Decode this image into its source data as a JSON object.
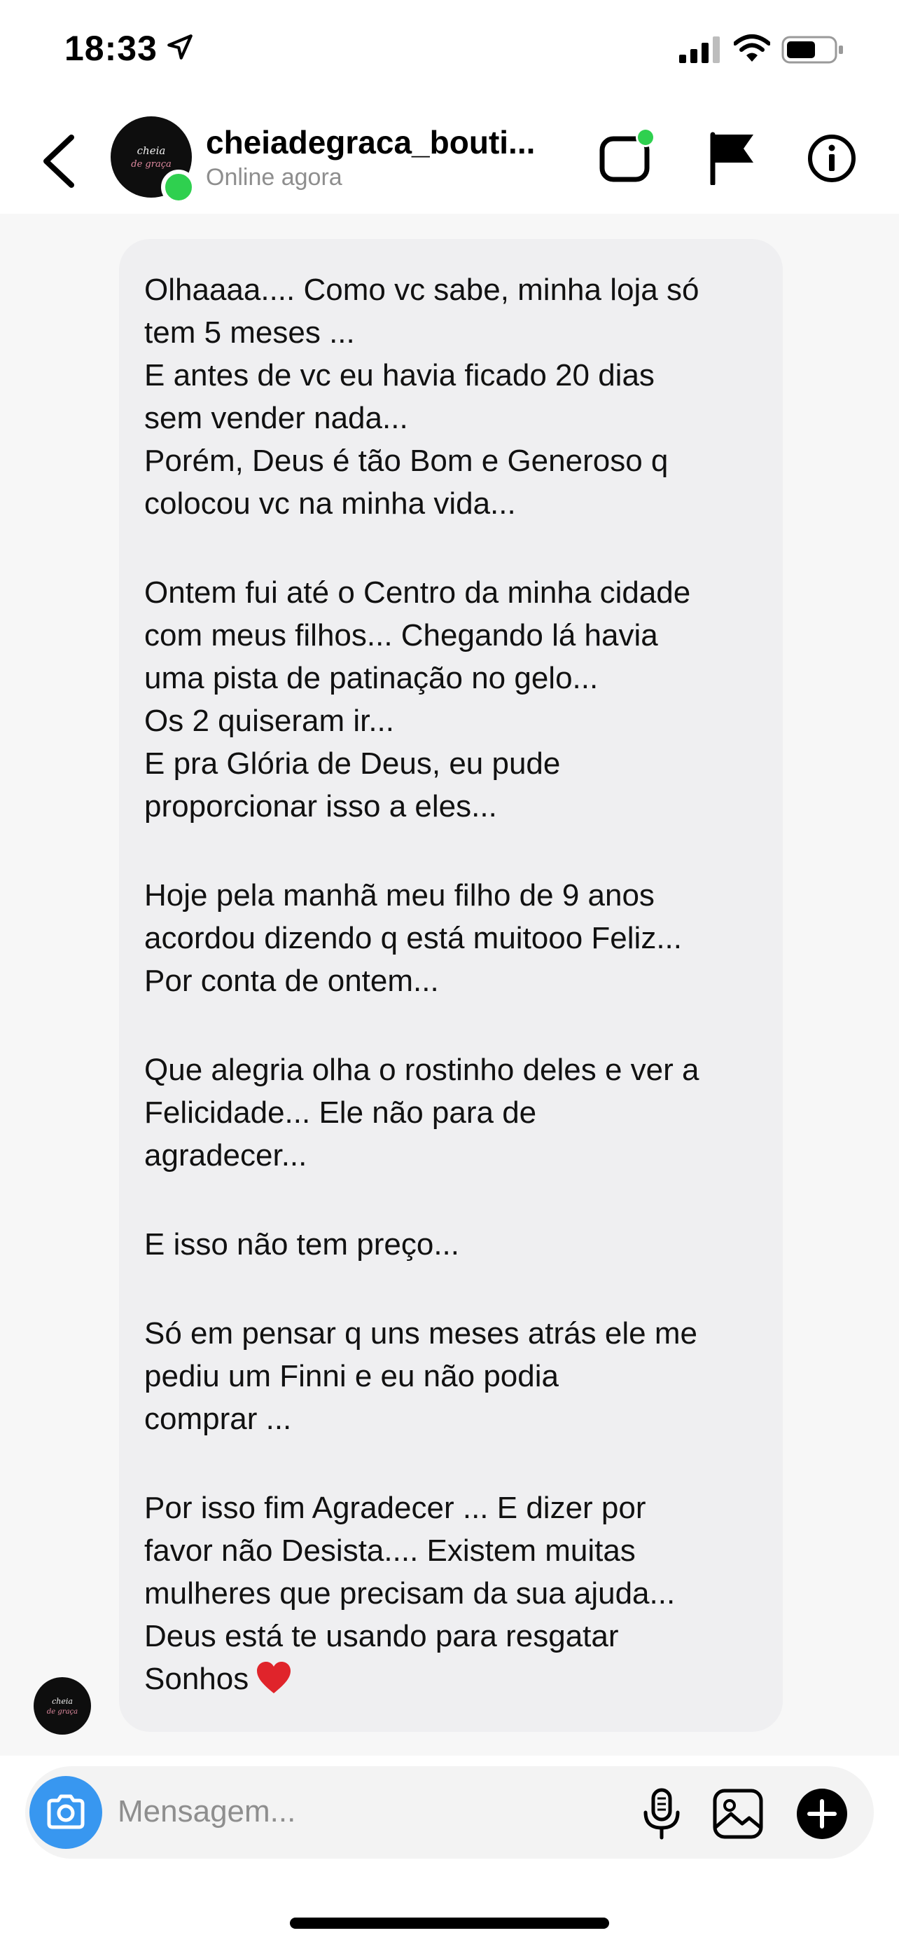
{
  "status_bar": {
    "time": "18:33"
  },
  "header": {
    "username": "cheiadegraca_bouti...",
    "status": "Online agora",
    "avatar_logo_text": "cheia de graça"
  },
  "message": {
    "paragraphs": [
      "Olhaaaa.... Como vc sabe, minha loja só\ntem 5 meses ...\nE antes de vc eu havia ficado 20 dias\nsem vender nada...\nPorém, Deus é tão Bom e Generoso q\ncolocou vc na minha vida...",
      "Ontem fui até o Centro da minha cidade\ncom meus filhos... Chegando lá havia\numa pista de patinação no gelo...\nOs 2 quiseram ir...\nE pra Glória de Deus, eu pude\nproporcionar isso a eles...",
      "Hoje pela manhã meu filho de 9 anos\nacordou dizendo q está muitooo Feliz...\nPor conta de ontem...",
      "Que alegria olha o rostinho deles e ver a\nFelicidade... Ele não para de\nagradecer...",
      "E isso não tem preço...",
      "Só em pensar q uns meses atrás ele me\npediu um Finni e eu não podia\ncomprar ...",
      "Por isso fim Agradecer ... E dizer por\nfavor não Desista.... Existem muitas\nmulheres que precisam da sua ajuda...\nDeus está te usando para resgatar\nSonhos"
    ],
    "emoji": "heart"
  },
  "composer": {
    "placeholder": "Mensagem..."
  },
  "icons": {
    "location": "location-arrow-icon",
    "video": "video-call-icon",
    "flag": "flag-icon",
    "info": "info-icon",
    "camera": "camera-icon",
    "mic": "microphone-icon",
    "gallery": "gallery-icon",
    "plus": "plus-icon"
  },
  "colors": {
    "online": "#2fd04f",
    "camera_button": "#3897f0",
    "bubble": "#efeff1",
    "heart": "#e0242b"
  }
}
